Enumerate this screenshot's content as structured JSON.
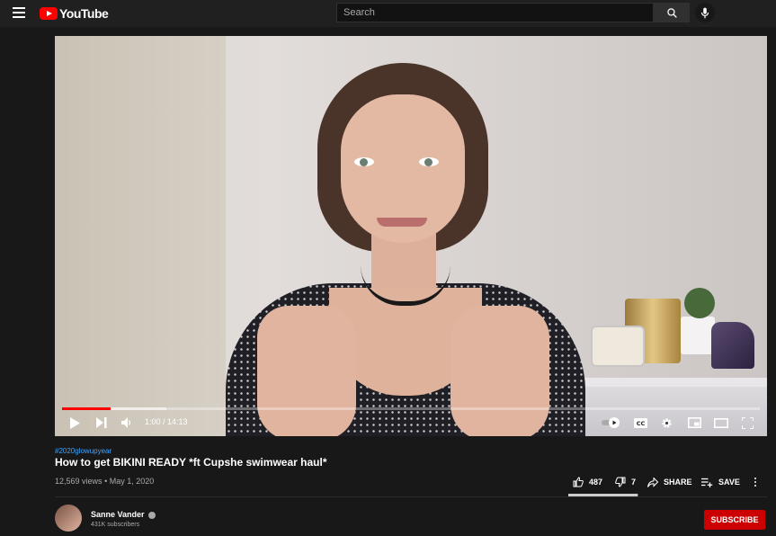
{
  "header": {
    "logo_text": "YouTube",
    "search_placeholder": "Search"
  },
  "player": {
    "current_time": "1:00",
    "duration": "14:13",
    "time_display": "1:00 / 14:13",
    "played_fraction": 0.07,
    "buffered_fraction": 0.15,
    "accent_color": "#ff0000",
    "controls": [
      "play-icon",
      "next-icon",
      "volume-icon",
      "autoplay-toggle-icon",
      "captions-icon",
      "settings-icon",
      "miniplayer-icon",
      "theater-mode-icon",
      "fullscreen-icon"
    ]
  },
  "video": {
    "hashtag": "#2020glowupyear",
    "title": "How to get BIKINI READY *ft Cupshe swimwear haul*",
    "views": "12,569 views",
    "separator": "•",
    "date": "May 1, 2020",
    "likes": "487",
    "dislikes": "7",
    "share_label": "SHARE",
    "save_label": "SAVE",
    "like_ratio": 0.985
  },
  "channel": {
    "name": "Sanne Vander",
    "subscribers": "431K subscribers",
    "subscribe_label": "SUBSCRIBE",
    "subscribe_color": "#cc0000"
  }
}
